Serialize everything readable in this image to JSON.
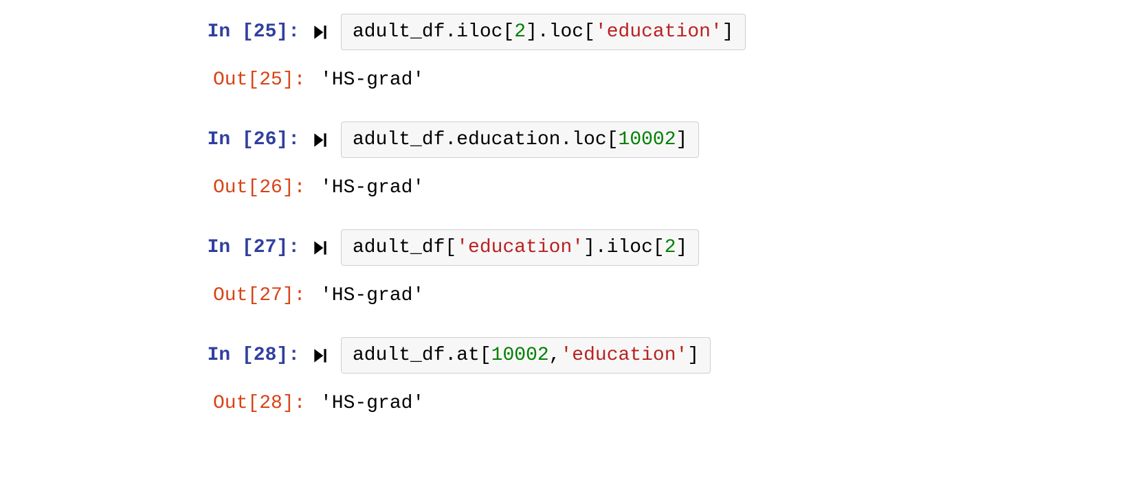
{
  "cells": [
    {
      "in_label": "In [25]:",
      "out_label": "Out[25]:",
      "code_tokens": [
        {
          "cls": "tok-ident",
          "t": "adult_df"
        },
        {
          "cls": "tok-punc",
          "t": "."
        },
        {
          "cls": "tok-ident",
          "t": "iloc"
        },
        {
          "cls": "tok-punc",
          "t": "["
        },
        {
          "cls": "tok-num",
          "t": "2"
        },
        {
          "cls": "tok-punc",
          "t": "]."
        },
        {
          "cls": "tok-ident",
          "t": "loc"
        },
        {
          "cls": "tok-punc",
          "t": "["
        },
        {
          "cls": "tok-str",
          "t": "'education'"
        },
        {
          "cls": "tok-punc",
          "t": "]"
        }
      ],
      "output": "'HS-grad'"
    },
    {
      "in_label": "In [26]:",
      "out_label": "Out[26]:",
      "code_tokens": [
        {
          "cls": "tok-ident",
          "t": "adult_df"
        },
        {
          "cls": "tok-punc",
          "t": "."
        },
        {
          "cls": "tok-ident",
          "t": "education"
        },
        {
          "cls": "tok-punc",
          "t": "."
        },
        {
          "cls": "tok-ident",
          "t": "loc"
        },
        {
          "cls": "tok-punc",
          "t": "["
        },
        {
          "cls": "tok-num",
          "t": "10002"
        },
        {
          "cls": "tok-punc",
          "t": "]"
        }
      ],
      "output": "'HS-grad'"
    },
    {
      "in_label": "In [27]:",
      "out_label": "Out[27]:",
      "code_tokens": [
        {
          "cls": "tok-ident",
          "t": "adult_df"
        },
        {
          "cls": "tok-punc",
          "t": "["
        },
        {
          "cls": "tok-str",
          "t": "'education'"
        },
        {
          "cls": "tok-punc",
          "t": "]."
        },
        {
          "cls": "tok-ident",
          "t": "iloc"
        },
        {
          "cls": "tok-punc",
          "t": "["
        },
        {
          "cls": "tok-num",
          "t": "2"
        },
        {
          "cls": "tok-punc",
          "t": "]"
        }
      ],
      "output": "'HS-grad'"
    },
    {
      "in_label": "In [28]:",
      "out_label": "Out[28]:",
      "code_tokens": [
        {
          "cls": "tok-ident",
          "t": "adult_df"
        },
        {
          "cls": "tok-punc",
          "t": "."
        },
        {
          "cls": "tok-ident",
          "t": "at"
        },
        {
          "cls": "tok-punc",
          "t": "["
        },
        {
          "cls": "tok-num",
          "t": "10002"
        },
        {
          "cls": "tok-punc",
          "t": ","
        },
        {
          "cls": "tok-str",
          "t": "'education'"
        },
        {
          "cls": "tok-punc",
          "t": "]"
        }
      ],
      "output": "'HS-grad'"
    }
  ]
}
